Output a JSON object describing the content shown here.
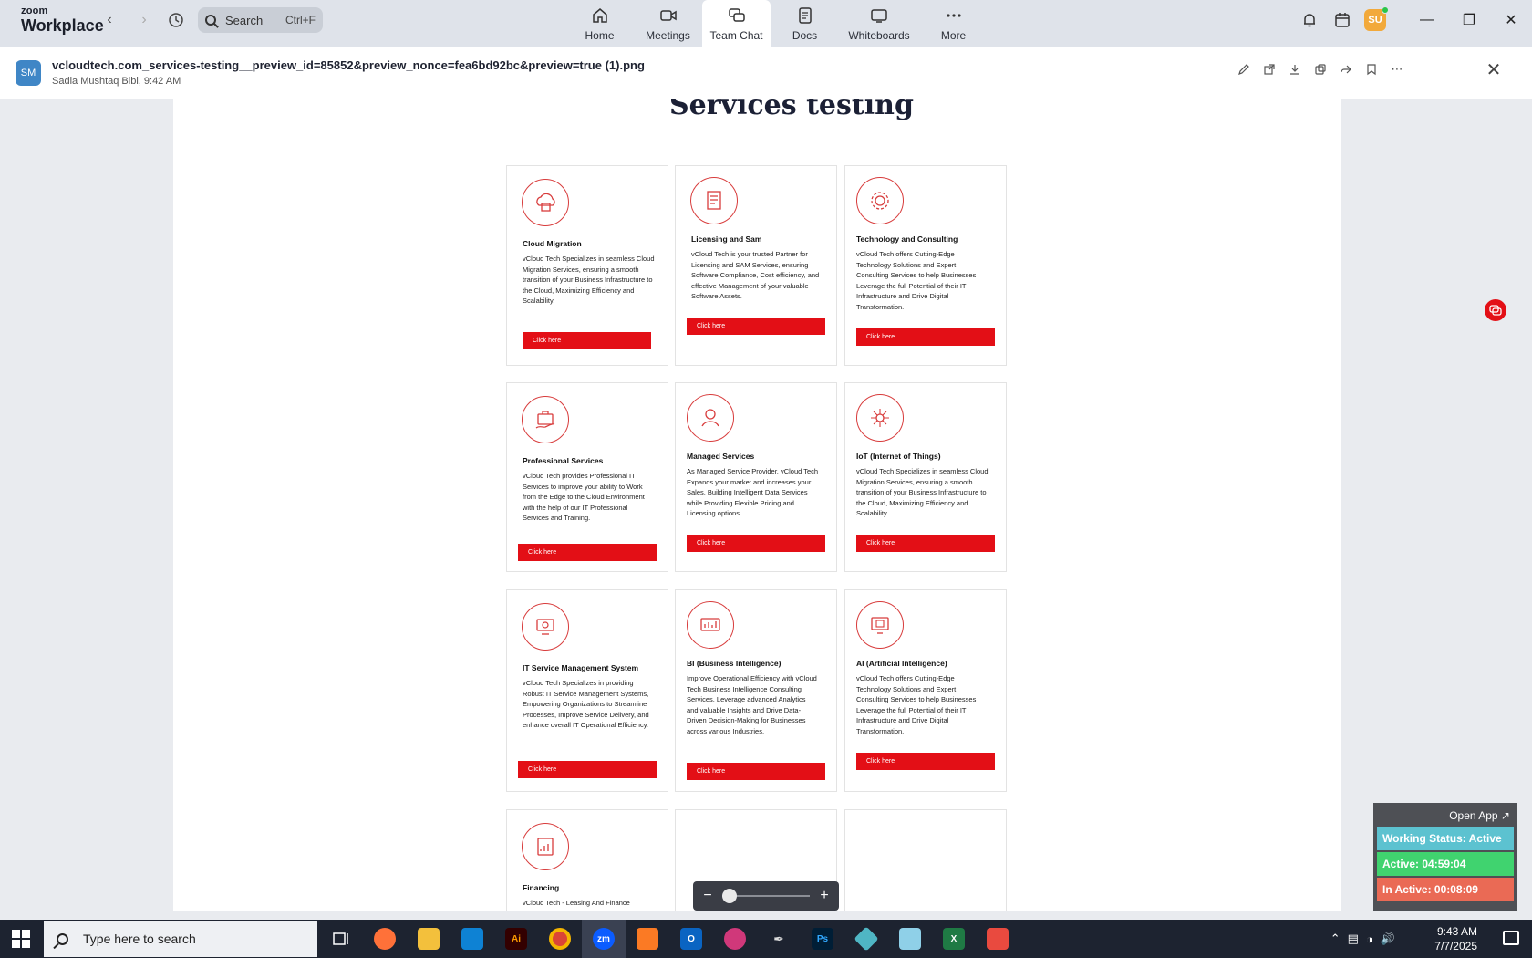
{
  "app": {
    "brand_top": "zoom",
    "brand_bottom": "Workplace"
  },
  "search": {
    "label": "Search",
    "shortcut": "Ctrl+F"
  },
  "tabs": [
    {
      "label": "Home",
      "icon": "home-icon"
    },
    {
      "label": "Meetings",
      "icon": "video-icon"
    },
    {
      "label": "Team Chat",
      "icon": "chat-icon"
    },
    {
      "label": "Docs",
      "icon": "docs-icon"
    },
    {
      "label": "Whiteboards",
      "icon": "whiteboard-icon"
    },
    {
      "label": "More",
      "icon": "more-icon"
    }
  ],
  "user": {
    "initials": "SU"
  },
  "file": {
    "avatar": "SM",
    "name": "vcloudtech.com_services-testing__preview_id=85852&preview_nonce=fea6bd92bc&preview=true (1).png",
    "sender": "Sadia Mushtaq Bibi, 9:42 AM"
  },
  "page": {
    "title": "Services testing"
  },
  "cards": [
    {
      "title": "Cloud Migration",
      "desc": "vCloud Tech Specializes in seamless Cloud Migration Services, ensuring a smooth transition of your Business Infrastructure to the Cloud, Maximizing Efficiency and Scalability.",
      "button": "Click here"
    },
    {
      "title": "Licensing and Sam",
      "desc": "vCloud Tech is your trusted Partner for Licensing and SAM Services, ensuring Software Compliance, Cost efficiency, and effective Management of your valuable Software Assets.",
      "button": "Click here"
    },
    {
      "title": "Technology and Consulting",
      "desc": "vCloud Tech offers Cutting-Edge Technology Solutions and Expert Consulting Services to help Businesses Leverage the full Potential of their IT Infrastructure and Drive Digital Transformation.",
      "button": "Click here"
    },
    {
      "title": "Professional Services",
      "desc": "vCloud Tech provides Professional IT Services to improve your ability to Work from the Edge to the Cloud Environment with the help of our IT Professional Services and Training.",
      "button": "Click here"
    },
    {
      "title": "Managed Services",
      "desc": "As Managed Service Provider, vCloud Tech Expands your market and increases your Sales, Building Intelligent Data Services while Providing Flexible Pricing and Licensing options.",
      "button": "Click here"
    },
    {
      "title": "IoT (Internet of Things)",
      "desc": "vCloud Tech Specializes in seamless Cloud Migration Services, ensuring a smooth transition of your Business Infrastructure to the Cloud, Maximizing Efficiency and Scalability.",
      "button": "Click here"
    },
    {
      "title": "IT Service Management System",
      "desc": "vCloud Tech Specializes in providing Robust IT Service Management Systems, Empowering Organizations to Streamline Processes, Improve Service Delivery, and enhance overall IT Operational Efficiency.",
      "button": "Click here"
    },
    {
      "title": "BI (Business Intelligence)",
      "desc": "Improve Operational Efficiency with vCloud Tech Business Intelligence Consulting Services. Leverage advanced Analytics and valuable Insights and Drive Data-Driven Decision-Making for Businesses across various Industries.",
      "button": "Click here"
    },
    {
      "title": "AI (Artificial Intelligence)",
      "desc": "vCloud Tech offers Cutting-Edge Technology Solutions and Expert Consulting Services to help Businesses Leverage the full Potential of their IT Infrastructure and Drive Digital Transformation.",
      "button": "Click here"
    },
    {
      "title": "Financing",
      "desc": "vCloud Tech - Leasing And Finance",
      "button": ""
    }
  ],
  "status": {
    "open_app": "Open App ↗",
    "working": "Working Status: Active",
    "active": "Active: 04:59:04",
    "inactive": "In Active: 00:08:09"
  },
  "taskbar": {
    "search_placeholder": "Type here to search",
    "time": "9:43 AM",
    "date": "7/7/2025"
  },
  "colors": {
    "accent_red": "#e30f16",
    "zoom_blue": "#0b5cff"
  }
}
